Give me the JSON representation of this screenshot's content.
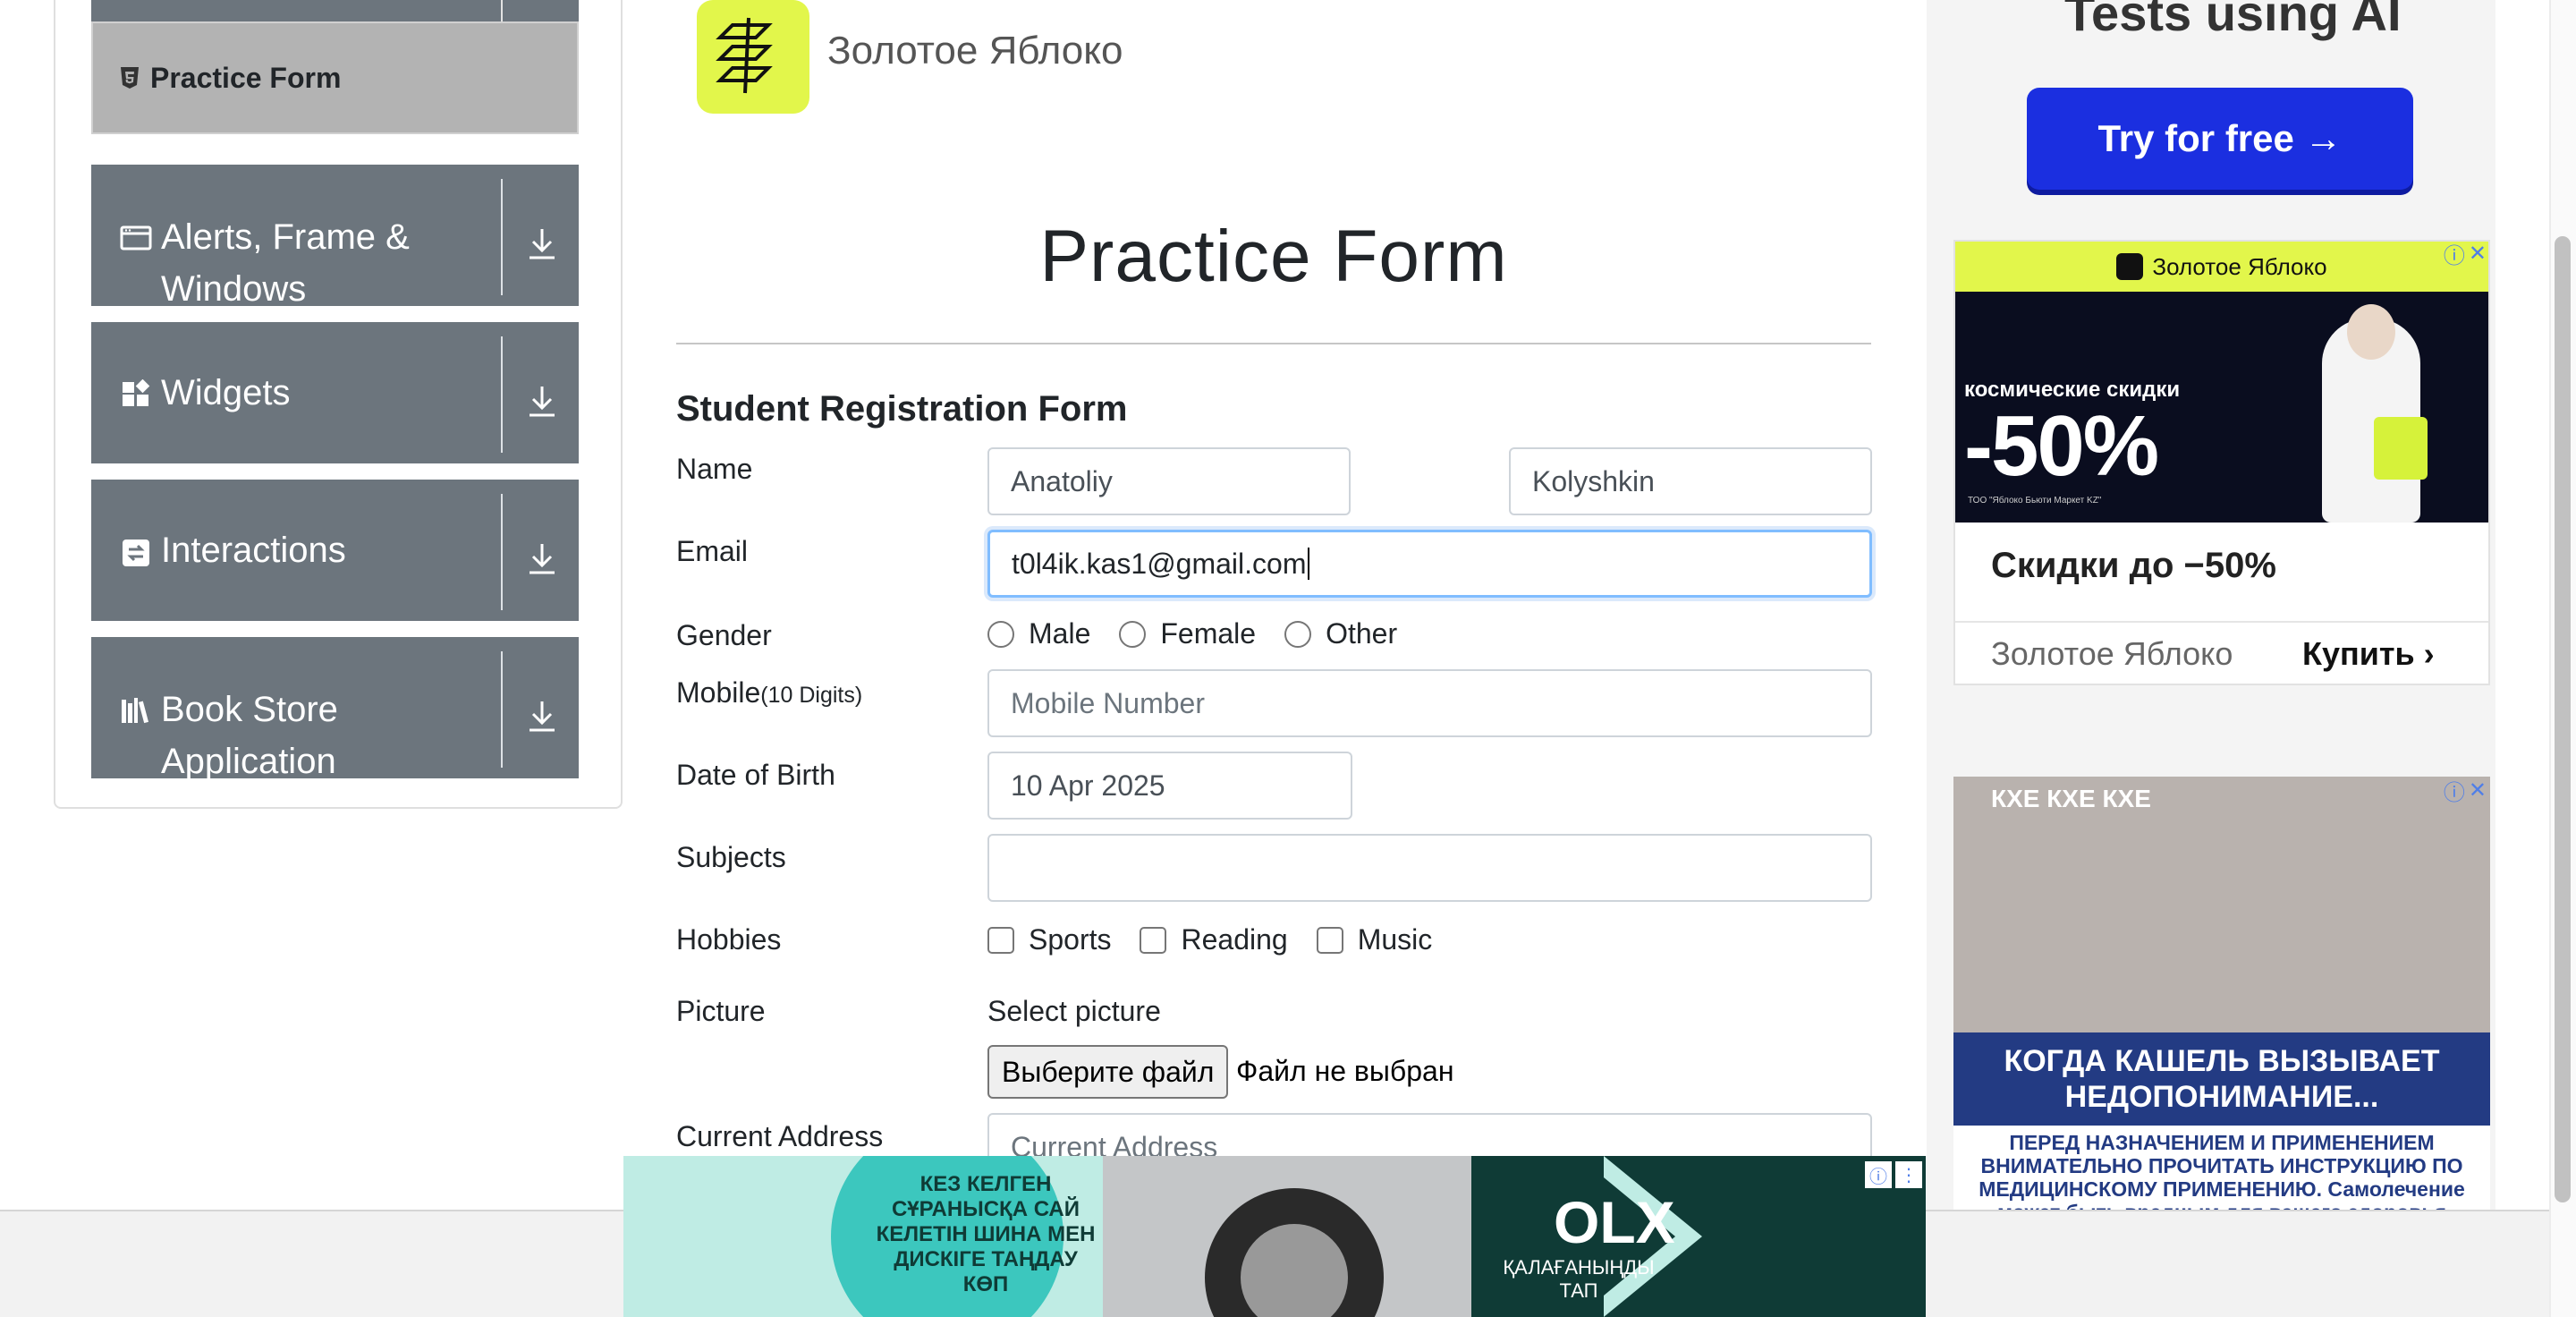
{
  "sidebar": {
    "active_item": "Practice Form",
    "groups": [
      {
        "title": "Alerts, Frame & Windows",
        "icon": "window-icon"
      },
      {
        "title": "Widgets",
        "icon": "widgets-icon"
      },
      {
        "title": "Interactions",
        "icon": "interactions-icon"
      },
      {
        "title": "Book Store Application",
        "icon": "books-icon"
      }
    ]
  },
  "header": {
    "brand_name": "Золотое Яблоко"
  },
  "main": {
    "page_title": "Practice Form",
    "form_heading": "Student Registration Form",
    "labels": {
      "name": "Name",
      "email": "Email",
      "gender": "Gender",
      "mobile": "Mobile",
      "mobile_hint": "(10 Digits)",
      "dob": "Date of Birth",
      "subjects": "Subjects",
      "hobbies": "Hobbies",
      "picture": "Picture",
      "address": "Current Address"
    },
    "fields": {
      "first_name": "Anatoliy",
      "last_name": "Kolyshkin",
      "email": "t0l4ik.kas1@gmail.com",
      "mobile_placeholder": "Mobile Number",
      "dob": "10 Apr 2025",
      "subjects": "",
      "address_placeholder": "Current Address"
    },
    "gender_options": [
      "Male",
      "Female",
      "Other"
    ],
    "hobby_options": [
      "Sports",
      "Reading",
      "Music"
    ],
    "picture": {
      "select_label": "Select picture",
      "button_label": "Выберите файл",
      "status": "Файл не выбран"
    }
  },
  "ads": {
    "top_text": "Tests using AI",
    "try_button": "Try for free →",
    "ad2": {
      "brand_header": "Золотое Яблоко",
      "discount_small": "космические скидки",
      "discount_big": "-50%",
      "fine": "ТОО \"Яблоко Бьюти Маркет KZ\"",
      "headline": "Скидки до −50%",
      "brand": "Золотое Яблоко",
      "cta": "Купить"
    },
    "ad3": {
      "kxe": "КХЕ КХЕ КХЕ",
      "banner": "КОГДА КАШЕЛЬ ВЫЗЫВАЕТ НЕДОПОНИМАНИЕ...",
      "fine": "ПЕРЕД НАЗНАЧЕНИЕМ И ПРИМЕНЕНИЕМ ВНИМАТЕЛЬНО ПРОЧИТАТЬ ИНСТРУКЦИЮ ПО МЕДИЦИНСКОМУ ПРИМЕНЕНИЮ. Самолечение может быть вредным для вашего здоровья"
    },
    "bottom": {
      "kz_text": "КЕЗ КЕЛГЕН СҰРАНЫСҚА САЙ КЕЛЕТІН ШИНА МЕН ДИСКІГЕ ТАҢДАУ КӨП",
      "logo": "OLX",
      "sub": "ҚАЛАҒАНЫҢДЫ ТАП"
    }
  },
  "colors": {
    "sidebar_group": "#6c757d",
    "active_item": "#b3b3b3",
    "brand_yellow": "#e2f64b",
    "focus_border": "#80bdff",
    "try_button": "#1b2fe0"
  }
}
